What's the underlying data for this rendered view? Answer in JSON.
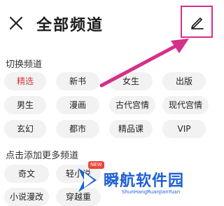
{
  "header": {
    "title": "全部频道",
    "close_icon": "close-icon",
    "edit_icon": "pencil-icon"
  },
  "sections": {
    "switch_title": "切换频道",
    "add_title": "点击添加更多频道"
  },
  "channels": [
    {
      "label": "精选",
      "active": true
    },
    {
      "label": "新书"
    },
    {
      "label": "女生"
    },
    {
      "label": "出版"
    },
    {
      "label": "男生"
    },
    {
      "label": "漫画"
    },
    {
      "label": "古代宫情"
    },
    {
      "label": "现代宫情"
    },
    {
      "label": "玄幻"
    },
    {
      "label": "都市"
    },
    {
      "label": "精品课"
    },
    {
      "label": "VIP"
    }
  ],
  "more_channels": [
    {
      "label": "奇文"
    },
    {
      "label": "轻小说",
      "badge": "NEW"
    },
    {
      "label": "小说漫改"
    },
    {
      "label": "穿越重"
    }
  ],
  "watermark": {
    "text": "瞬航软件园",
    "sub": "ShunHangRuanJianYuan"
  },
  "colors": {
    "accent": "#d43b3b",
    "arrow": "#d62f8a",
    "chip_bg": "#f2f2f2",
    "watermark": "#1e5fd6"
  }
}
